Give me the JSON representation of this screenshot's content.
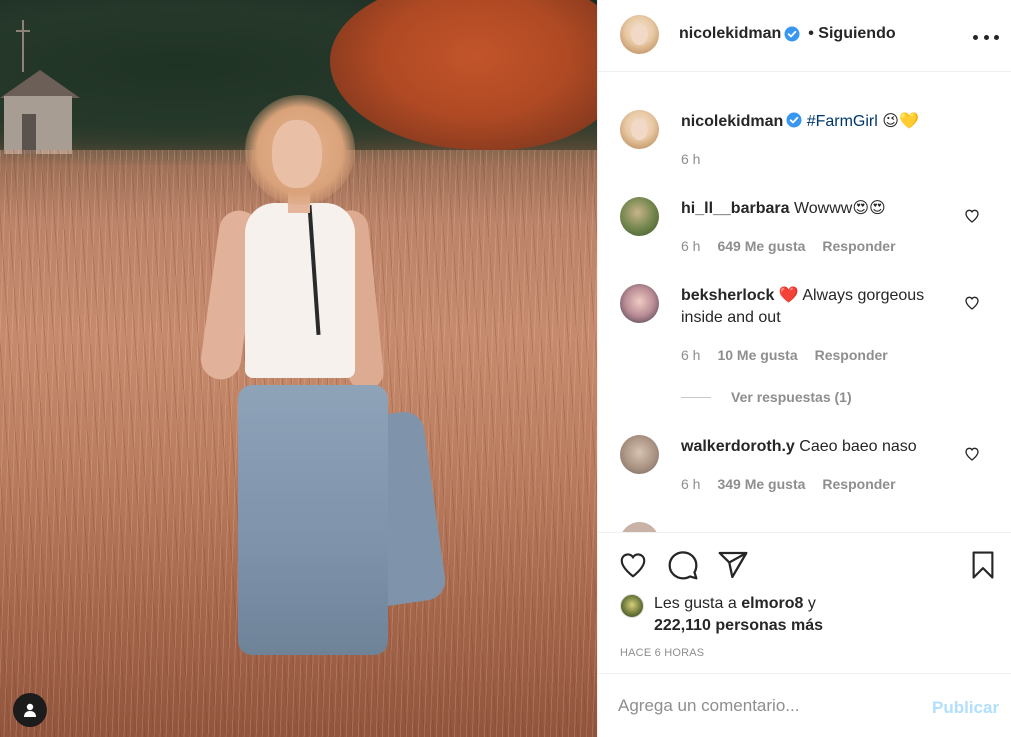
{
  "post": {
    "author": "nicolekidman",
    "follow_status": "• Siguiendo"
  },
  "caption": {
    "username": "nicolekidman",
    "hashtag": "#FarmGirl",
    "emojis": "😉💛",
    "time": "6 h"
  },
  "comments": [
    {
      "username": "hi_ll__barbara",
      "text": "Wowww😍😍",
      "time": "6 h",
      "likes": "649 Me gusta",
      "reply": "Responder"
    },
    {
      "username": "beksherlock",
      "text": "❤️ Always gorgeous inside and out",
      "time": "6 h",
      "likes": "10 Me gusta",
      "reply": "Responder",
      "view_replies": "Ver respuestas (1)"
    },
    {
      "username": "walkerdoroth.y",
      "text": "Caeo baeo naso",
      "time": "6 h",
      "likes": "349 Me gusta",
      "reply": "Responder"
    }
  ],
  "likes": {
    "prefix": "Les gusta a",
    "user": "elmoro8",
    "connector": "y",
    "count": "222,110 personas más"
  },
  "time_ago": "HACE 6 HORAS",
  "comment_box": {
    "placeholder": "Agrega un comentario...",
    "publish": "Publicar"
  },
  "colors": {
    "verified": "#3897f0",
    "link": "#00376b",
    "muted": "#8e8e8e",
    "publish_disabled": "#b2dffc",
    "heart_red": "#ed4956"
  },
  "icons": [
    "user-icon",
    "verified-icon",
    "more-options-icon",
    "heart-icon",
    "comment-icon",
    "share-icon",
    "bookmark-icon"
  ]
}
